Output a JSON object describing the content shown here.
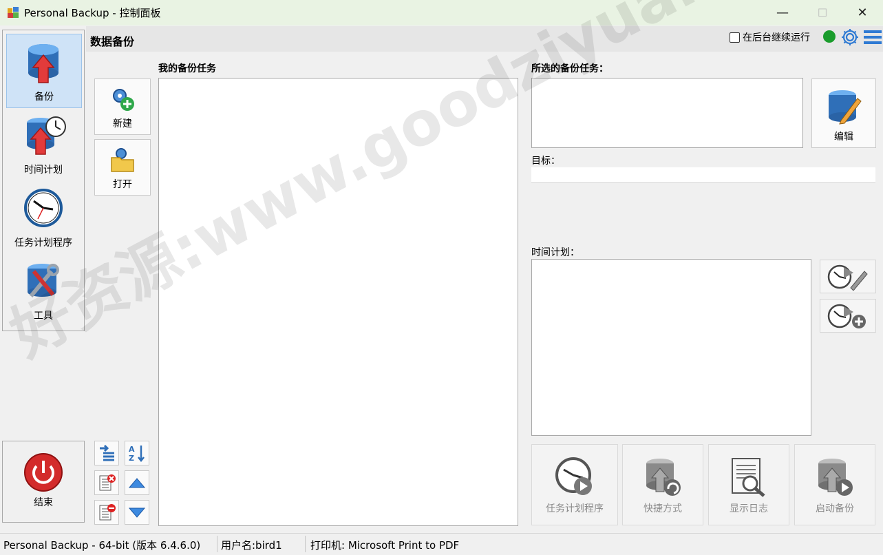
{
  "window": {
    "title": "Personal Backup - 控制面板",
    "minimize_glyph": "—",
    "maximize_glyph": "☐",
    "close_glyph": "✕"
  },
  "header": {
    "title": "数据备份",
    "background_run_label": "在后台继续运行",
    "background_run_checked": false,
    "status_color": "#1a9c2c"
  },
  "nav": {
    "items": [
      {
        "label": "备份",
        "icon": "database-upload-icon",
        "active": true
      },
      {
        "label": "时间计划",
        "icon": "database-clock-icon",
        "active": false
      },
      {
        "label": "任务计划程序",
        "icon": "clock-icon",
        "active": false
      },
      {
        "label": "工具",
        "icon": "tools-icon",
        "active": false
      }
    ],
    "exit_label": "结束"
  },
  "toolbar": {
    "new_label": "新建",
    "open_label": "打开"
  },
  "tasks": {
    "label": "我的备份任务",
    "items": []
  },
  "selected": {
    "label": "所选的备份任务：",
    "value": "",
    "edit_label": "编辑",
    "target_label": "目标：",
    "target_value": "",
    "schedule_label": "时间计划："
  },
  "actions": {
    "scheduler_label": "任务计划程序",
    "shortcut_label": "快捷方式",
    "showlog_label": "显示日志",
    "start_label": "启动备份"
  },
  "statusbar": {
    "version": "Personal Backup - 64-bit (版本 6.4.6.0)",
    "user": "用户名:bird1",
    "printer": "打印机: Microsoft Print to PDF"
  },
  "watermark": "好资源:www.goodziyuan.com"
}
